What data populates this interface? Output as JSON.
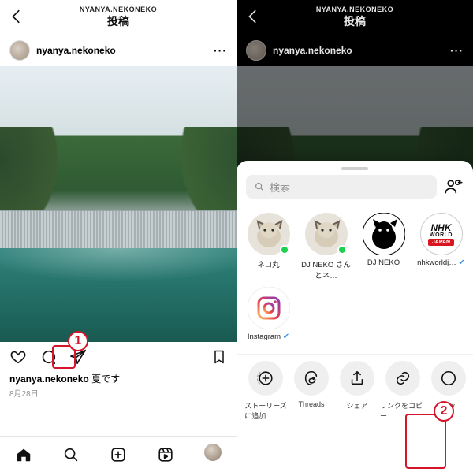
{
  "left": {
    "header": {
      "subtitle": "NYANYA.NEKONEKO",
      "title": "投稿"
    },
    "user": {
      "name": "nyanya.nekoneko"
    },
    "caption_user": "nyanya.nekoneko",
    "caption_text": "夏です",
    "date": "8月28日",
    "callout": "1"
  },
  "right": {
    "header": {
      "subtitle": "NYANYA.NEKONEKO",
      "title": "投稿"
    },
    "user": {
      "name": "nyanya.nekoneko"
    },
    "search_placeholder": "検索",
    "contacts": [
      {
        "label": "ネコ丸",
        "online": true
      },
      {
        "label": "DJ NEKO さんとネ…",
        "online": true
      },
      {
        "label": "DJ NEKO"
      },
      {
        "label": "nhkworldj…",
        "verified": true,
        "brand": "nhk"
      },
      {
        "label": "Instagram",
        "verified": true,
        "brand": "ig"
      }
    ],
    "share_items": [
      {
        "label": "ストーリーズに追加",
        "icon": "story"
      },
      {
        "label": "Threads",
        "icon": "threads"
      },
      {
        "label": "シェア",
        "icon": "share"
      },
      {
        "label": "リンクをコピー",
        "icon": "link"
      },
      {
        "label": "メッ",
        "icon": "message"
      }
    ],
    "callout": "2"
  }
}
